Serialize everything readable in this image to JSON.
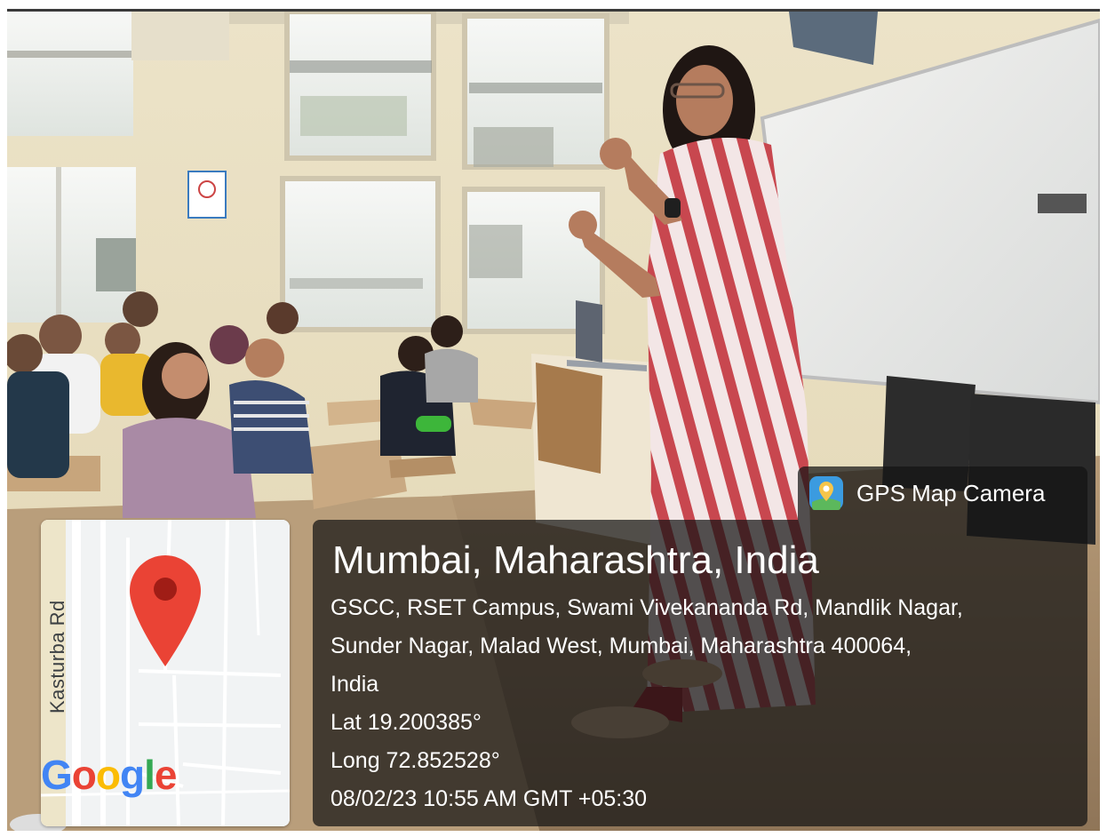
{
  "overlay": {
    "badge_label": "GPS Map Camera",
    "location_title": "Mumbai, Maharashtra, India",
    "address_lines": [
      "GSCC, RSET Campus, Swami Vivekananda Rd, Mandlik Nagar,",
      "Sunder Nagar, Malad West, Mumbai, Maharashtra 400064,",
      "India"
    ],
    "latitude": "Lat 19.200385°",
    "longitude": "Long 72.852528°",
    "datetime": "08/02/23 10:55 AM GMT +05:30"
  },
  "map": {
    "road_label": "Kasturba Rd",
    "logo_letters": [
      "G",
      "o",
      "o",
      "g",
      "l",
      "e"
    ],
    "logo_colors": [
      "#4285F4",
      "#EA4335",
      "#FBBC05",
      "#4285F4",
      "#34A853",
      "#EA4335"
    ],
    "pin_color": "#EA4335"
  },
  "icons": {
    "gps_app_icon": "gps-map-camera-icon",
    "map_pin": "location-pin-icon"
  }
}
